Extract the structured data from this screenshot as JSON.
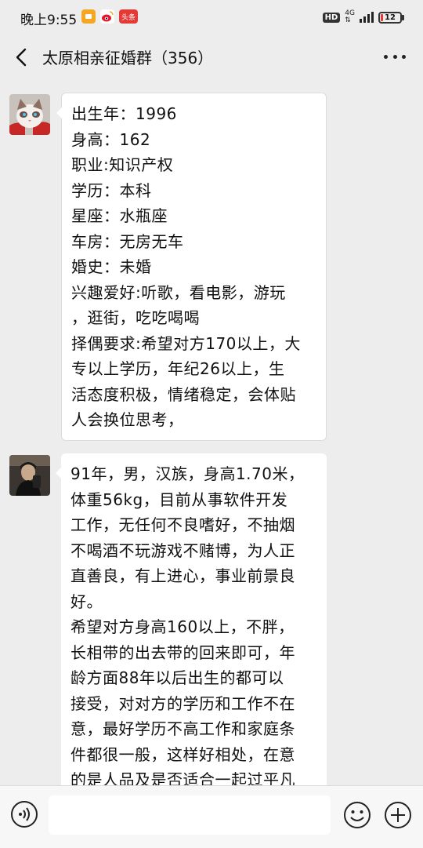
{
  "status_bar": {
    "time": "晚上9:55",
    "app_icons": [
      "wechat-app-icon",
      "weibo-app-icon",
      "toutiao-app-icon"
    ],
    "toutiao_label": "头条",
    "hd": "HD",
    "network": "4G",
    "battery": "12",
    "battery_level": 0.12,
    "battery_color": "#e53935"
  },
  "header": {
    "title": "太原相亲征婚群（356）",
    "back_icon": "chevron-left-icon",
    "more_icon": "more-dots-icon"
  },
  "messages": [
    {
      "avatar": "cat-avatar",
      "lines": [
        "出生年：1996",
        "身高：162",
        "职业:知识产权",
        "学历：本科",
        "星座：水瓶座",
        "车房：无房无车",
        "婚史：未婚",
        "兴趣爱好:听歌，看电影，游玩",
        "，逛街，吃吃喝喝",
        "择偶要求:希望对方170以上，大",
        "专以上学历，年纪26以上，生",
        "活态度积极，情绪稳定，会体贴",
        "人会换位思考，"
      ]
    },
    {
      "avatar": "man-selfie-avatar",
      "lines": [
        "91年，男，汉族，身高1.70米，",
        "体重56kg，目前从事软件开发",
        "工作，无任何不良嗜好，不抽烟",
        "不喝酒不玩游戏不赌博，为人正",
        "直善良，有上进心，事业前景良",
        "好。",
        "希望对方身高160以上，不胖，",
        "长相带的出去带的回来即可，年",
        "龄方面88年以后出生的都可以",
        "接受，对对方的学历和工作不在",
        "意，最好学历不高工作和家庭条",
        "件都很一般，这样好相处，在意",
        "的是人品及是否适合一起过平凡"
      ]
    }
  ],
  "input_bar": {
    "placeholder": "",
    "voice_icon": "voice-icon",
    "emoji_icon": "emoji-icon",
    "plus_icon": "plus-icon"
  },
  "colors": {
    "background": "#ededed",
    "bubble": "#ffffff",
    "text": "#111111"
  }
}
